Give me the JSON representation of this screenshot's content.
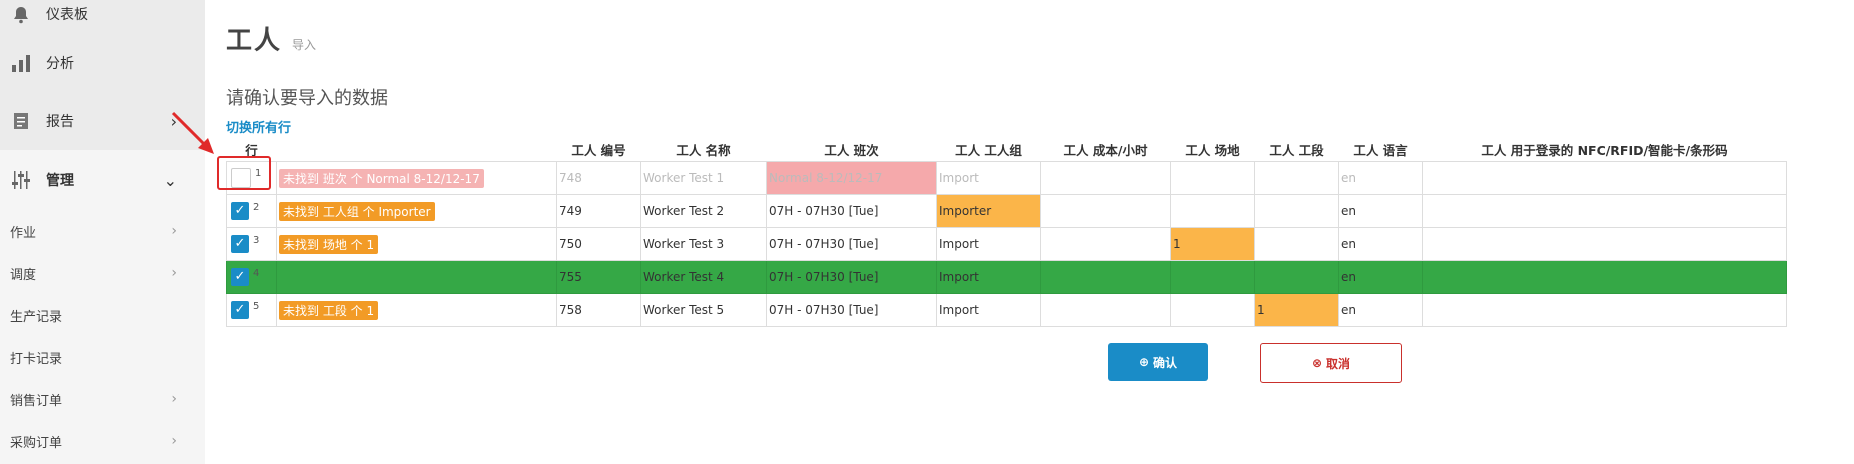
{
  "sidebar": {
    "dashboard": "仪表板",
    "analysis": "分析",
    "reports": "报告",
    "management": "管理",
    "sub_items": [
      "作业",
      "调度",
      "生产记录",
      "打卡记录",
      "销售订单",
      "采购订单"
    ]
  },
  "page": {
    "title": "工人",
    "subtitle": "导入",
    "confirm_heading": "请确认要导入的数据",
    "toggle_all": "切换所有行"
  },
  "table": {
    "headers": [
      "行",
      "",
      "工人 编号",
      "工人 名称",
      "工人 班次",
      "工人 工人组",
      "工人 成本/小时",
      "工人 场地",
      "工人 工段",
      "工人 语言",
      "工人 用于登录的 NFC/RFID/智能卡/条形码"
    ],
    "rows": [
      {
        "num": "1",
        "checked": false,
        "error": "未找到 班次 个 Normal 8-12/12-17",
        "id": "748",
        "name": "Worker Test 1",
        "shift": "Normal 8-12/12-17",
        "group": "Import",
        "cost": "",
        "site": "",
        "section": "",
        "lang": "en",
        "nfc": ""
      },
      {
        "num": "2",
        "checked": true,
        "error": "未找到 工人组 个 Importer",
        "id": "749",
        "name": "Worker Test 2",
        "shift": "07H - 07H30 [Tue]",
        "group": "Importer",
        "cost": "",
        "site": "",
        "section": "",
        "lang": "en",
        "nfc": ""
      },
      {
        "num": "3",
        "checked": true,
        "error": "未找到 场地 个 1",
        "id": "750",
        "name": "Worker Test 3",
        "shift": "07H - 07H30 [Tue]",
        "group": "Import",
        "cost": "",
        "site": "1",
        "section": "",
        "lang": "en",
        "nfc": ""
      },
      {
        "num": "4",
        "checked": true,
        "error": "",
        "id": "755",
        "name": "Worker Test 4",
        "shift": "07H - 07H30 [Tue]",
        "group": "Import",
        "cost": "",
        "site": "",
        "section": "",
        "lang": "en",
        "nfc": ""
      },
      {
        "num": "5",
        "checked": true,
        "error": "未找到 工段 个 1",
        "id": "758",
        "name": "Worker Test 5",
        "shift": "07H - 07H30 [Tue]",
        "group": "Import",
        "cost": "",
        "site": "",
        "section": "1",
        "lang": "en",
        "nfc": ""
      }
    ]
  },
  "buttons": {
    "confirm": "确认",
    "cancel": "取消"
  },
  "colors": {
    "accent": "#1a8cc7",
    "error_tag": "#f29b26",
    "ok_row": "#35a846",
    "missing_shift": "#f5a9ab",
    "missing_value": "#fbb549",
    "highlight": "#e02a2a"
  }
}
